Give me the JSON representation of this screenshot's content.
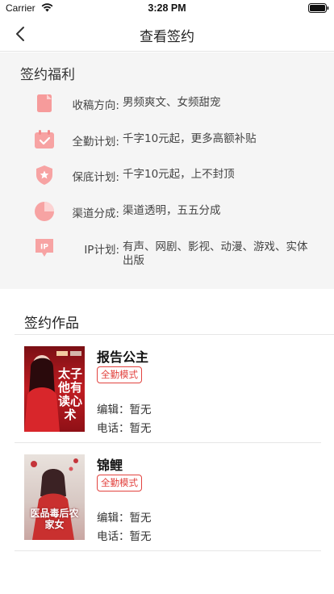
{
  "status_bar": {
    "carrier": "Carrier",
    "time": "3:28 PM"
  },
  "nav": {
    "title": "查看签约"
  },
  "benefits": {
    "title": "签约福利",
    "items": [
      {
        "icon": "document-icon",
        "label": "收稿方向:",
        "text": "男频爽文、女频甜宠"
      },
      {
        "icon": "calendar-check-icon",
        "label": "全勤计划:",
        "text": "千字10元起，更多高额补贴"
      },
      {
        "icon": "shield-star-icon",
        "label": "保底计划:",
        "text": "千字10元起，上不封顶"
      },
      {
        "icon": "pie-chart-icon",
        "label": "渠道分成:",
        "text": "渠道透明，五五分成"
      },
      {
        "icon": "ip-badge-icon",
        "label": "IP计划:",
        "text": "有声、网剧、影视、动漫、游戏、实体出版"
      }
    ]
  },
  "works": {
    "title": "签约作品",
    "items": [
      {
        "title": "报告公主",
        "badge": "全勤模式",
        "editor": "编辑：暂无",
        "phone": "电话：暂无",
        "cover_text": "太子他有读心术"
      },
      {
        "title": "锦鲤",
        "badge": "全勤模式",
        "editor": "编辑：暂无",
        "phone": "电话：暂无",
        "cover_text": "医品毒后农家女"
      }
    ]
  },
  "colors": {
    "accent": "#e2433f",
    "icon_pink": "#f7a3a3",
    "section_bg": "#f5f5f5"
  }
}
